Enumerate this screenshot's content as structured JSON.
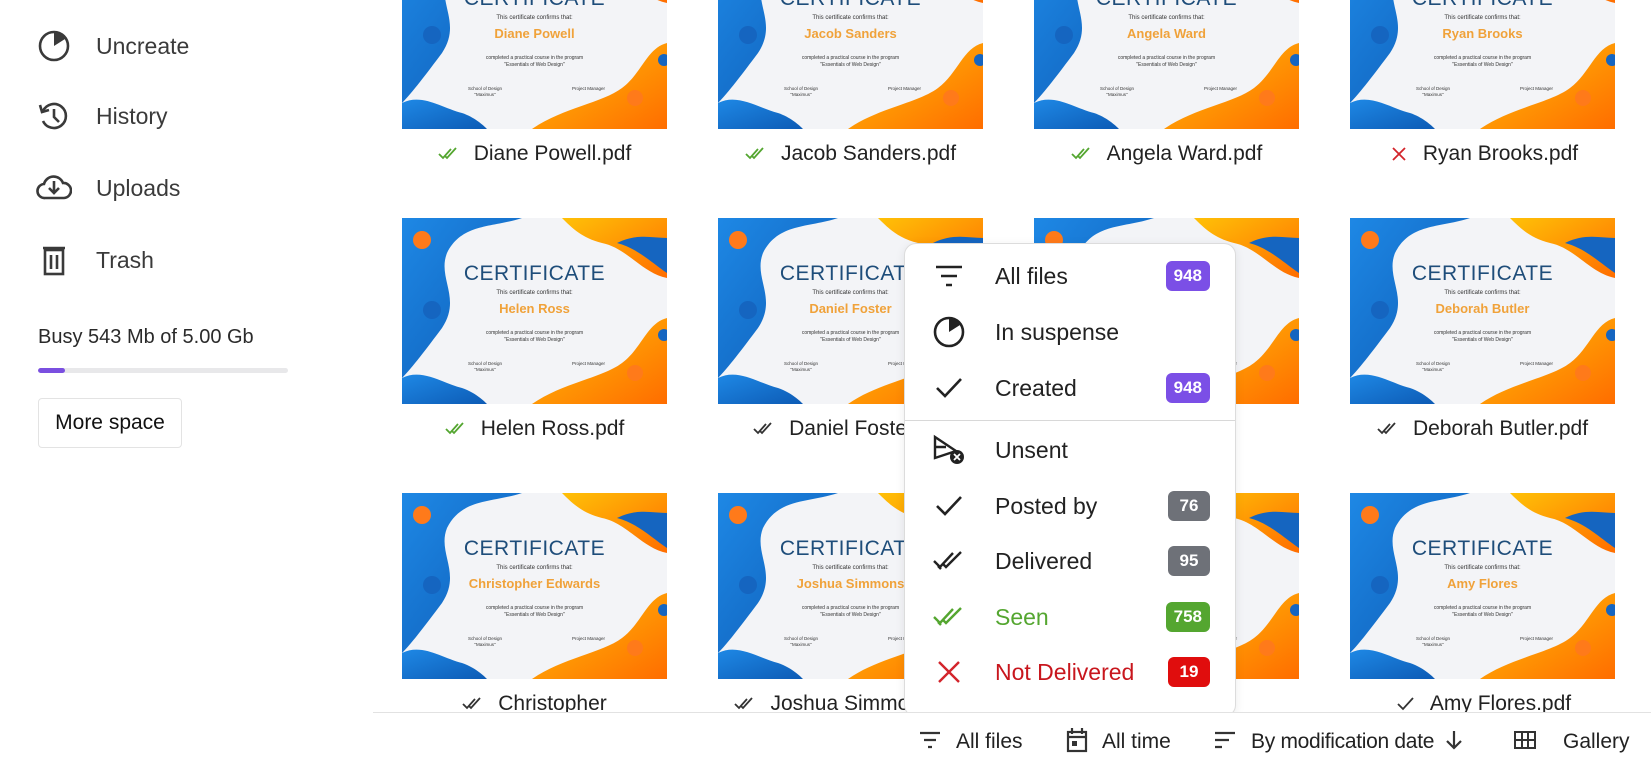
{
  "sidebar": {
    "items": [
      {
        "label": "Uncreate",
        "icon": "pie-clock-icon"
      },
      {
        "label": "History",
        "icon": "history-icon"
      },
      {
        "label": "Uploads",
        "icon": "cloud-download-icon"
      },
      {
        "label": "Trash",
        "icon": "trash-icon"
      }
    ],
    "storage": {
      "text": "Busy 543 Mb of 5.00 Gb",
      "used_fraction": 0.106,
      "accent": "#7a4fe0"
    },
    "more_space_label": "More space"
  },
  "certificate_template": {
    "title": "CERTIFICATE",
    "subtitle": "This certificate confirms that:",
    "desc_line1": "completed a practical course in the program",
    "desc_line2": "\"Essentials of Web Design\"",
    "school_line1": "School of Design",
    "school_line2": "\"Maximus\"",
    "manager": "Project Manager"
  },
  "files": [
    {
      "name": "Diane Powell",
      "file": "Diane Powell.pdf",
      "status": "seen"
    },
    {
      "name": "Jacob Sanders",
      "file": "Jacob Sanders.pdf",
      "status": "seen"
    },
    {
      "name": "Angela Ward",
      "file": "Angela Ward.pdf",
      "status": "seen"
    },
    {
      "name": "Ryan Brooks",
      "file": "Ryan Brooks.pdf",
      "status": "not-delivered"
    },
    {
      "name": "Helen Ross",
      "file": "Helen Ross.pdf",
      "status": "seen"
    },
    {
      "name": "Daniel Foster",
      "file": "Daniel Foster.pdf",
      "status": "delivered"
    },
    {
      "name": "",
      "file": ".pdf",
      "status": "none"
    },
    {
      "name": "Deborah Butler",
      "file": "Deborah Butler.pdf",
      "status": "delivered"
    },
    {
      "name": "Christopher Edwards",
      "file": "Christopher",
      "status": "delivered"
    },
    {
      "name": "Joshua Simmons",
      "file": "Joshua Simmons.pdf",
      "status": "delivered"
    },
    {
      "name": "",
      "file": ".pdf",
      "status": "none"
    },
    {
      "name": "Amy Flores",
      "file": "Amy Flores.pdf",
      "status": "posted"
    }
  ],
  "filter_menu": {
    "items": [
      {
        "label": "All files",
        "icon": "filter-icon",
        "badge": "948",
        "badge_color": "#7b4fe6",
        "text_color": "#222222"
      },
      {
        "label": "In suspense",
        "icon": "pie-clock-icon",
        "badge": null,
        "text_color": "#222222"
      },
      {
        "label": "Created",
        "icon": "check-icon",
        "badge": "948",
        "badge_color": "#7b4fe6",
        "text_color": "#222222"
      },
      {
        "label": "Unsent",
        "icon": "send-cancel-icon",
        "badge": null,
        "text_color": "#222222"
      },
      {
        "label": "Posted by",
        "icon": "check-icon",
        "badge": "76",
        "badge_color": "#6e7178",
        "text_color": "#222222"
      },
      {
        "label": "Delivered",
        "icon": "double-check-icon",
        "badge": "95",
        "badge_color": "#6e7178",
        "text_color": "#222222"
      },
      {
        "label": "Seen",
        "icon": "double-check-green-icon",
        "badge": "758",
        "badge_color": "#54a630",
        "text_color": "#54a630"
      },
      {
        "label": "Not Delivered",
        "icon": "x-icon",
        "badge": "19",
        "badge_color": "#e00d0d",
        "text_color": "#c8161d"
      }
    ]
  },
  "toolbar": {
    "filter_label": "All files",
    "time_label": "All time",
    "sort_label": "By modification date",
    "view_label": "Gallery"
  },
  "colors": {
    "seen": "#54a630",
    "not_delivered": "#d3242b",
    "delivered": "#333333"
  }
}
